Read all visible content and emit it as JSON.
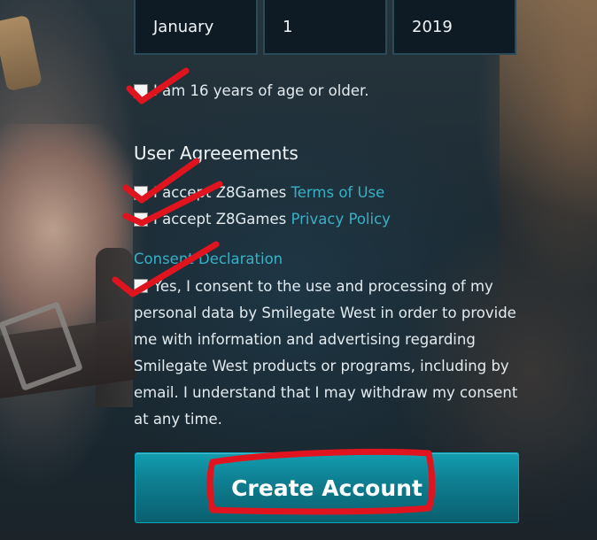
{
  "dob": {
    "month": "January",
    "day": "1",
    "year": "2019"
  },
  "age_check": {
    "label": "I am 16 years of age or older."
  },
  "user_agreements": {
    "title": "User Agreeements",
    "terms_prefix": "I accept Z8Games ",
    "terms_link": "Terms of Use",
    "privacy_prefix": "I accept Z8Games ",
    "privacy_link": "Privacy Policy"
  },
  "consent": {
    "title": "Consent Declaration",
    "text": "Yes, I consent to the use and processing of my personal data by Smilegate West in order to provide me with information and advertising regarding Smilegate West products or programs, including by email. I understand that I may withdraw my consent at any time."
  },
  "create_button": {
    "label": "Create Account"
  },
  "colors": {
    "accent": "#39b0c6",
    "button": "#0e7f91",
    "annotation": "#e0141e"
  }
}
